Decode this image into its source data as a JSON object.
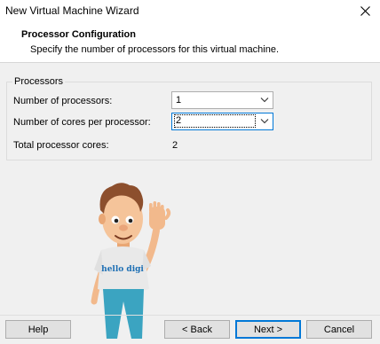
{
  "window": {
    "title": "New Virtual Machine Wizard"
  },
  "header": {
    "title": "Processor Configuration",
    "subtitle": "Specify the number of processors for this virtual machine."
  },
  "processors": {
    "group_label": "Processors",
    "num_processors": {
      "label": "Number of processors:",
      "value": "1"
    },
    "cores_per_processor": {
      "label": "Number of cores per processor:",
      "value": "2"
    },
    "total_cores": {
      "label": "Total processor cores:",
      "value": "2"
    }
  },
  "mascot": {
    "shirt_text": "hello digi"
  },
  "footer": {
    "help_label": "Help",
    "back_label": "< Back",
    "next_label": "Next >",
    "cancel_label": "Cancel"
  }
}
